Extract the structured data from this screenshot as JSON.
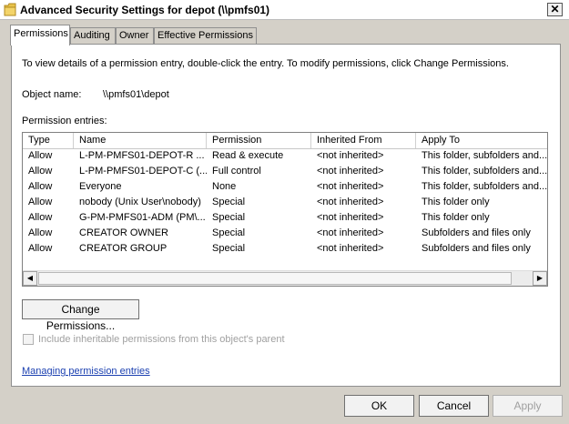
{
  "window": {
    "title": "Advanced Security Settings for depot (\\\\pmfs01)",
    "close_symbol": "✕"
  },
  "tabs": [
    {
      "label": "Permissions",
      "active": true
    },
    {
      "label": "Auditing",
      "active": false
    },
    {
      "label": "Owner",
      "active": false
    },
    {
      "label": "Effective Permissions",
      "active": false
    }
  ],
  "permissions_tab": {
    "instructions": "To view details of a permission entry, double-click the entry. To modify permissions, click Change Permissions.",
    "object_name_label": "Object name:",
    "object_name_value": "\\\\pmfs01\\depot",
    "entries_label": "Permission entries:",
    "columns": [
      "Type",
      "Name",
      "Permission",
      "Inherited From",
      "Apply To"
    ],
    "rows": [
      [
        "Allow",
        "L-PM-PMFS01-DEPOT-R ...",
        "Read & execute",
        "<not inherited>",
        "This folder, subfolders and..."
      ],
      [
        "Allow",
        "L-PM-PMFS01-DEPOT-C (...",
        "Full control",
        "<not inherited>",
        "This folder, subfolders and..."
      ],
      [
        "Allow",
        "Everyone",
        "None",
        "<not inherited>",
        "This folder, subfolders and..."
      ],
      [
        "Allow",
        "nobody (Unix User\\nobody)",
        "Special",
        "<not inherited>",
        "This folder only"
      ],
      [
        "Allow",
        "G-PM-PMFS01-ADM (PM\\...",
        "Special",
        "<not inherited>",
        "This folder only"
      ],
      [
        "Allow",
        "CREATOR OWNER",
        "Special",
        "<not inherited>",
        "Subfolders and files only"
      ],
      [
        "Allow",
        "CREATOR GROUP",
        "Special",
        "<not inherited>",
        "Subfolders and files only"
      ]
    ],
    "scroll_left": "◀",
    "scroll_right": "▶",
    "change_permissions_label": "Change Permissions...",
    "include_inheritable_label": "Include inheritable permissions from this object's parent",
    "managing_link": "Managing permission entries"
  },
  "footer": {
    "ok_label": "OK",
    "cancel_label": "Cancel",
    "apply_label": "Apply"
  },
  "colors": {
    "link": "#1a3fb0",
    "folder_icon": "#e8c24a",
    "disabled_text": "#a0a0a0"
  }
}
